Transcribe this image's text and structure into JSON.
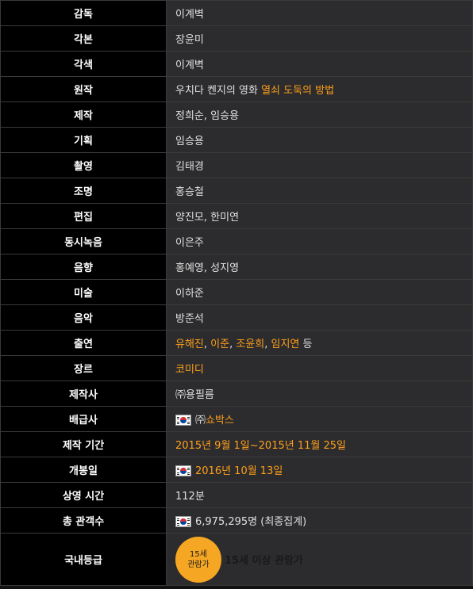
{
  "rows": [
    {
      "label": "감독",
      "value": "이계벽"
    },
    {
      "label": "각본",
      "value": "장윤미"
    },
    {
      "label": "각색",
      "value": "이계벽"
    },
    {
      "label": "원작",
      "prefix": "우치다 켄지의 영화 ",
      "link": "열쇠 도둑의 방법"
    },
    {
      "label": "제작",
      "value": "정희순, 임승용"
    },
    {
      "label": "기획",
      "value": "임승용"
    },
    {
      "label": "촬영",
      "value": "김태경"
    },
    {
      "label": "조명",
      "value": "홍승철"
    },
    {
      "label": "편집",
      "value": "양진모, 한미연"
    },
    {
      "label": "동시녹음",
      "value": "이은주"
    },
    {
      "label": "음향",
      "value": "홍예영, 성지영"
    },
    {
      "label": "미술",
      "value": "이하준"
    },
    {
      "label": "음악",
      "value": "방준석"
    },
    {
      "label": "출연",
      "cast": [
        "유해진",
        "이준",
        "조윤희",
        "임지연"
      ],
      "sep": ", ",
      "suffix": " 등"
    },
    {
      "label": "장르",
      "link": "코미디"
    },
    {
      "label": "제작사",
      "value": "㈜용필름"
    },
    {
      "label": "배급사",
      "flag": "south-korea-flag",
      "prefix": "㈜",
      "link": "쇼박스"
    },
    {
      "label": "제작 기간",
      "link": "2015년 9월 1일~2015년 11월 25일"
    },
    {
      "label": "개봉일",
      "flag": "south-korea-flag",
      "link": "2016년 10월 13일"
    },
    {
      "label": "상영 시간",
      "value": "112분"
    },
    {
      "label": "총 관객수",
      "flag": "south-korea-flag",
      "value": "6,975,295명 (최종집계)"
    },
    {
      "label": "국내등급",
      "badge_line1": "15세",
      "badge_line2": "관람가",
      "value": "15세 이상 관람가"
    }
  ],
  "colors": {
    "link": "#ff9f1a",
    "label_bg": "#000000",
    "value_bg": "#2c2c2e",
    "badge": "#f5a623"
  }
}
